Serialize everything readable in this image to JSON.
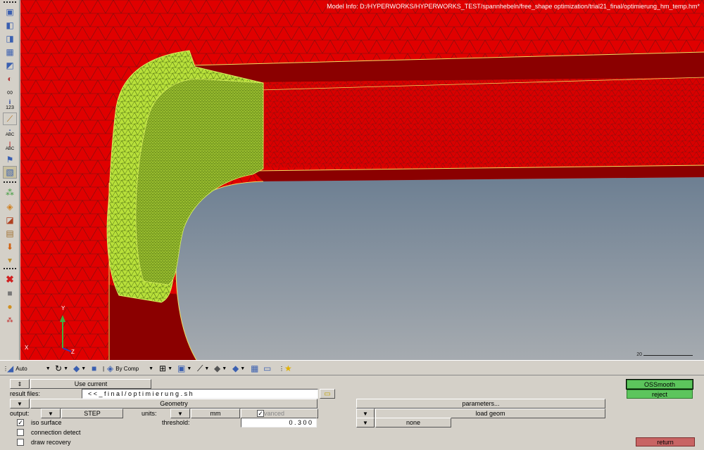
{
  "viewport": {
    "model_info": "Model Info: D:/HYPERWORKS/HYPERWORKS_TEST/spannhebeln/free_shape optimization/trial21_final/optimierung_hm_temp.hm*",
    "axis_y": "Y",
    "axis_z": "Z",
    "axis_x": "X",
    "scale_label": "20",
    "colors": {
      "mesh_red": "#e00000",
      "dark_red": "#8b0000",
      "yellow_green": "#b8e03a",
      "steel": "#8a9aaa"
    }
  },
  "left_toolbar": {
    "icons": [
      "cube-view-icon",
      "cube-view-icon",
      "cube-view-icon",
      "cube-view-icon",
      "cube-view-icon",
      "shading-icon",
      "link-icon",
      "info-icon",
      "ruler-icon",
      "label-abc-icon",
      "label-abc-icon",
      "label-abc-icon",
      "frame-icon",
      "spheres-icon",
      "layers-icon",
      "component-icon",
      "stack-icon",
      "load-icon",
      "folder-icon",
      "delete-icon",
      "cube-gray-icon",
      "globe-icon",
      "axis-icon"
    ],
    "info_label": "123",
    "abc_label": "ABC"
  },
  "bottom_toolbar": {
    "auto_label": "Auto",
    "by_comp_label": "By Comp"
  },
  "panel": {
    "use_current": "Use current",
    "result_files_label": "result files:",
    "result_files_value": "< < _ f i n a l / o p t i m i e r u n g . s h",
    "geometry_label": "Geometry",
    "output_label": "output:",
    "output_value": "STEP",
    "units_label": "units:",
    "units_value": "mm",
    "advanced_label": "advanced",
    "threshold_label": "threshold:",
    "threshold_value": "0 . 3 0 0",
    "iso_surface_label": "iso surface",
    "connection_detect_label": "connection detect",
    "draw_recovery_label": "draw recovery",
    "parameters_label": "parameters...",
    "load_geom_label": "load geom",
    "none_label": "none",
    "ossmooth_label": "OSSmooth",
    "reject_label": "reject",
    "return_label": "return"
  }
}
